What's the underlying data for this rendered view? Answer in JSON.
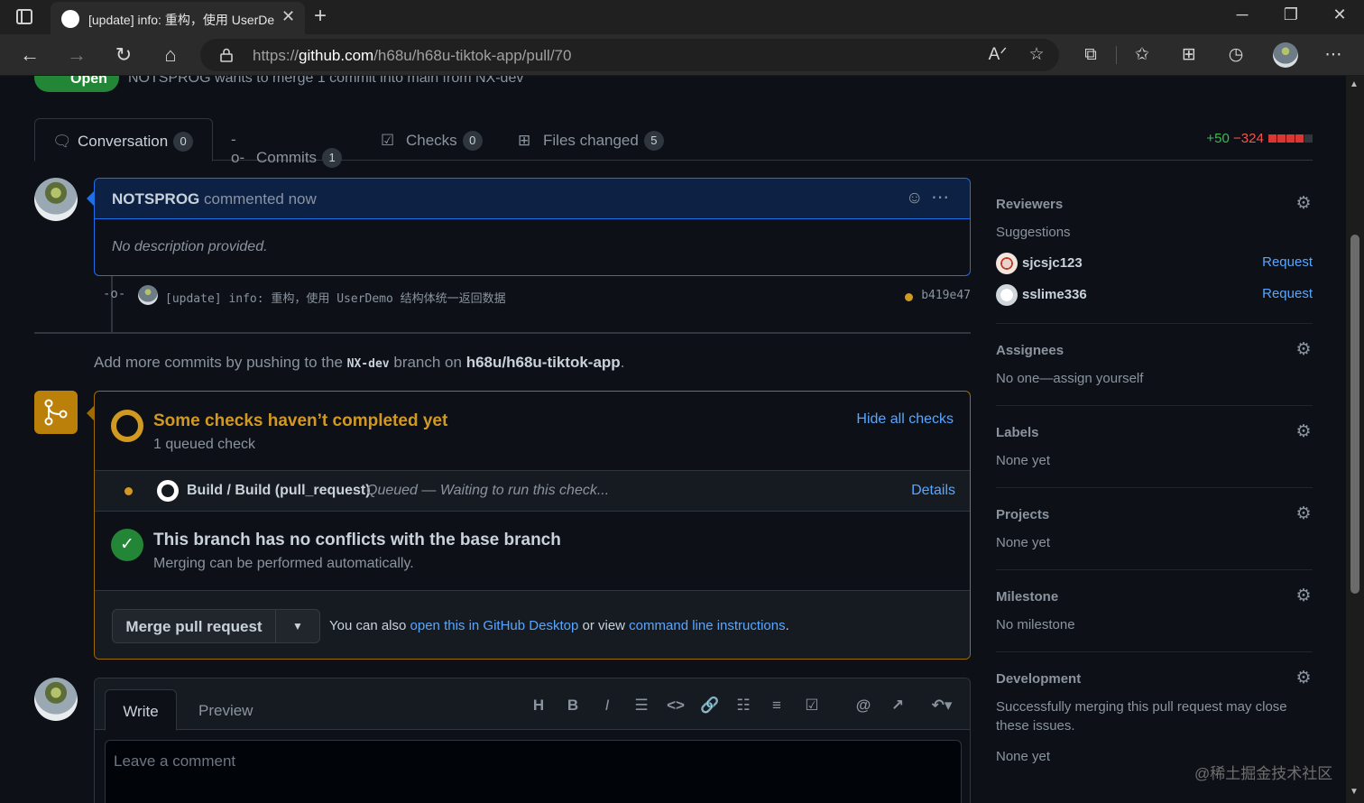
{
  "browser": {
    "tab_title": "[update] info: 重构，使用 UserDe",
    "url_prefix": "https://",
    "url_host": "github.com",
    "url_path": "/h68u/h68u-tiktok-app/pull/70"
  },
  "pr": {
    "state_label": "Open",
    "header_partial": "NOTSPROG wants to merge 1 commit into main from NX-dev"
  },
  "tabs": [
    {
      "label": "Conversation",
      "count": "0"
    },
    {
      "label": "Commits",
      "count": "1"
    },
    {
      "label": "Checks",
      "count": "0"
    },
    {
      "label": "Files changed",
      "count": "5"
    }
  ],
  "diffstat": {
    "additions": "+50",
    "deletions": "−324"
  },
  "comment": {
    "author": "NOTSPROG",
    "action": "commented now",
    "body": "No description provided."
  },
  "commit": {
    "message": "[update] info: 重构，使用 UserDemo 结构体统一返回数据",
    "sha": "b419e47"
  },
  "push_hint": {
    "prefix": "Add more commits by pushing to the",
    "branch": "NX-dev",
    "middle": "branch on",
    "repo": "h68u/h68u-tiktok-app",
    "suffix": "."
  },
  "checks": {
    "title": "Some checks haven’t completed yet",
    "subtitle": "1 queued check",
    "hide_label": "Hide all checks",
    "row_name": "Build / Build (pull_request)",
    "row_status": "Queued — Waiting to run this check...",
    "row_details": "Details"
  },
  "conflicts": {
    "title": "This branch has no conflicts with the base branch",
    "subtitle": "Merging can be performed automatically."
  },
  "merge": {
    "button": "Merge pull request",
    "also_prefix": "You can also",
    "desktop_link": "open this in GitHub Desktop",
    "or_view": "or view",
    "cli_link": "command line instructions",
    "suffix": "."
  },
  "editor": {
    "write_tab": "Write",
    "preview_tab": "Preview",
    "placeholder": "Leave a comment"
  },
  "sidebar": {
    "reviewers": {
      "heading": "Reviewers",
      "suggestions": "Suggestions",
      "people": [
        {
          "name": "sjcsjc123",
          "action": "Request"
        },
        {
          "name": "sslime336",
          "action": "Request"
        }
      ]
    },
    "assignees": {
      "heading": "Assignees",
      "value": "No one—assign yourself"
    },
    "labels": {
      "heading": "Labels",
      "value": "None yet"
    },
    "projects": {
      "heading": "Projects",
      "value": "None yet"
    },
    "milestone": {
      "heading": "Milestone",
      "value": "No milestone"
    },
    "development": {
      "heading": "Development",
      "description": "Successfully merging this pull request may close these issues.",
      "value": "None yet"
    }
  },
  "watermark": "@稀土掘金技术社区",
  "colors": {
    "accent_blue": "#58a6ff",
    "success_green": "#238636",
    "pending_yellow": "#d29922",
    "danger_red": "#f85149"
  }
}
